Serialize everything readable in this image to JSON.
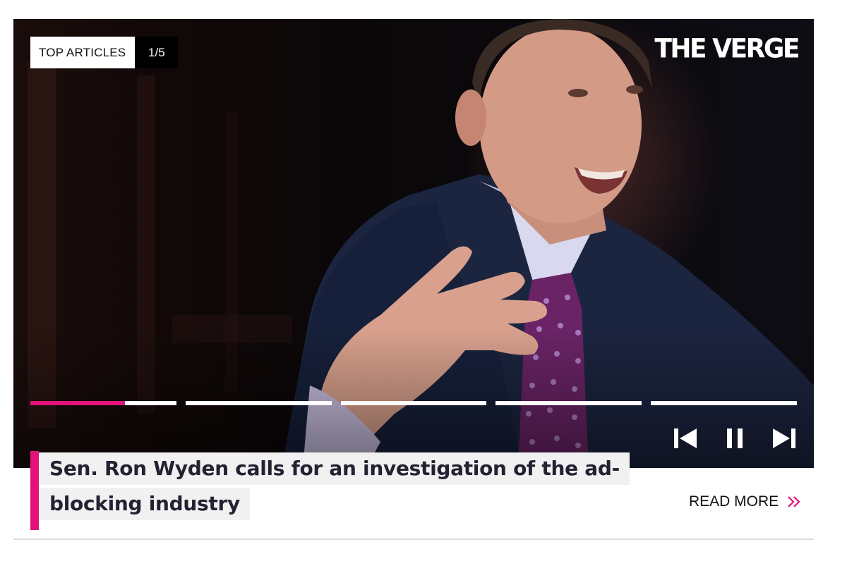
{
  "badge": {
    "label": "TOP ARTICLES",
    "counter": "1/5"
  },
  "brand": {
    "logo_text": "THE VERGE"
  },
  "slideshow": {
    "total_slides": 5,
    "current_slide": 1,
    "current_progress": 0.65,
    "accent_color": "#e2127a",
    "track_color": "#ffffff"
  },
  "controls": {
    "previous_icon": "skip-previous-icon",
    "pause_icon": "pause-icon",
    "next_icon": "skip-next-icon"
  },
  "article": {
    "headline": "Sen. Ron Wyden calls for an investigation of the ad-blocking industry",
    "read_more_label": "READ MORE",
    "read_more_icon": "double-chevron-right-icon"
  }
}
